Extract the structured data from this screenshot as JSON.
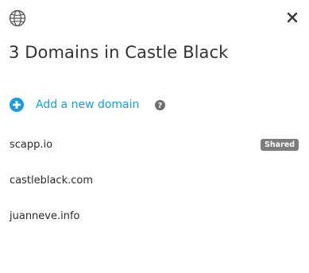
{
  "header": {
    "icon": "globe-icon",
    "close_icon": "close-icon",
    "title": "3 Domains in Castle Black"
  },
  "actions": {
    "add_icon": "plus-circle-icon",
    "add_label": "Add a new domain",
    "help_icon": "help-icon",
    "accent_color": "#1a9de0"
  },
  "domains": [
    {
      "name": "scapp.io",
      "badge": "Shared"
    },
    {
      "name": "castleblack.com",
      "badge": ""
    },
    {
      "name": "juanneve.info",
      "badge": ""
    }
  ]
}
